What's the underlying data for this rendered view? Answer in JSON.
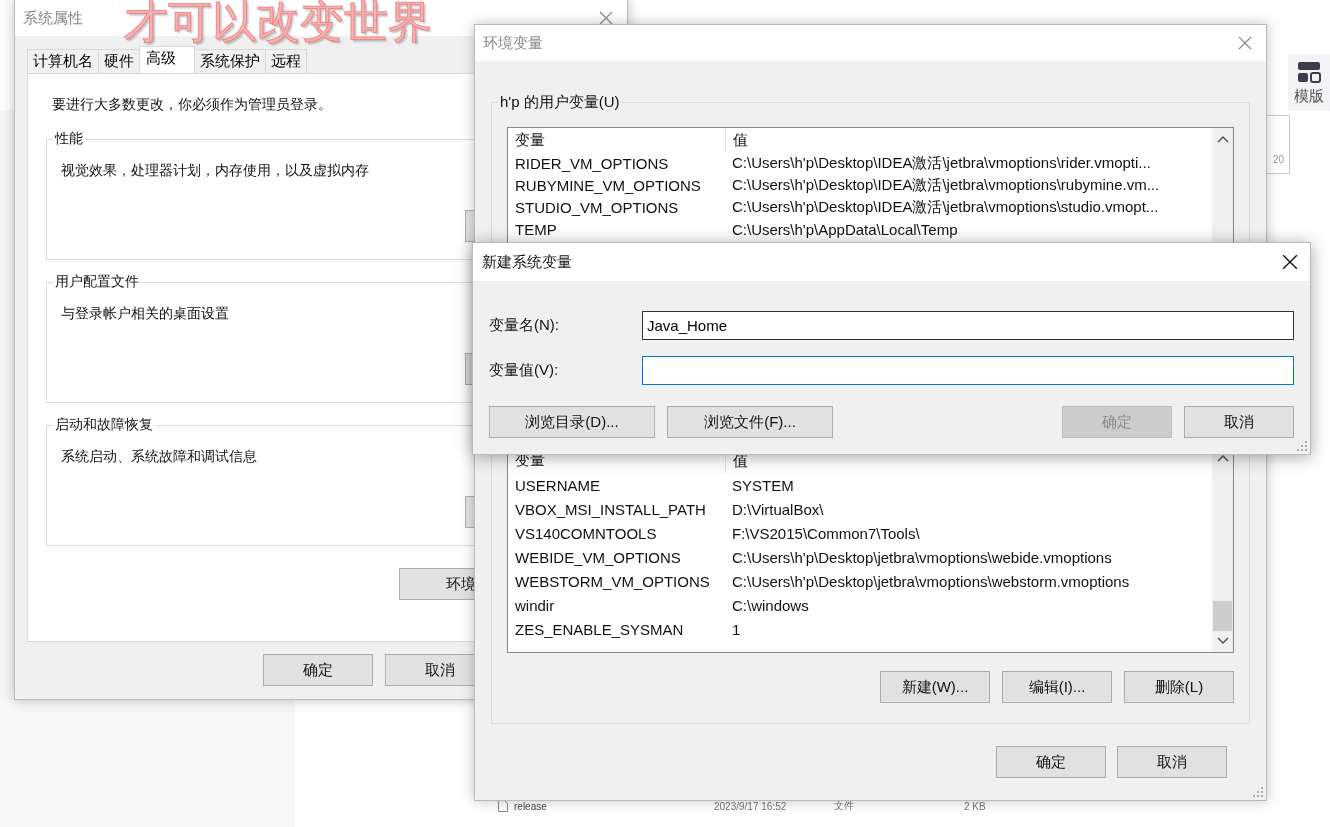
{
  "overlay_caption": "才可以改变世界",
  "background_app": {
    "toolbar_button": "模版",
    "thumbnail_label": "20",
    "file_row": {
      "name": "release",
      "modified": "2023/9/17 16:52",
      "type": "文件",
      "size": "2 KB"
    }
  },
  "system_properties": {
    "title": "系统属性",
    "tabs": [
      {
        "label": "计算机名",
        "selected": false
      },
      {
        "label": "硬件",
        "selected": false
      },
      {
        "label": "高级",
        "selected": true
      },
      {
        "label": "系统保护",
        "selected": false
      },
      {
        "label": "远程",
        "selected": false
      }
    ],
    "admin_note": "要进行大多数更改，你必须作为管理员登录。",
    "groups": [
      {
        "title": "性能",
        "description": "视觉效果，处理器计划，内存使用，以及虚拟内存"
      },
      {
        "title": "用户配置文件",
        "description": "与登录帐户相关的桌面设置"
      },
      {
        "title": "启动和故障恢复",
        "description": "系统启动、系统故障和调试信息"
      }
    ],
    "env_button": "环境",
    "buttons": [
      "确定",
      "取消"
    ]
  },
  "environment_variables": {
    "title": "环境变量",
    "user_group_title": "h'p 的用户变量(U)",
    "user_columns": [
      "变量",
      "值"
    ],
    "user_rows": [
      {
        "name": "RIDER_VM_OPTIONS",
        "value": "C:\\Users\\h'p\\Desktop\\IDEA激活\\jetbra\\vmoptions\\rider.vmopti..."
      },
      {
        "name": "RUBYMINE_VM_OPTIONS",
        "value": "C:\\Users\\h'p\\Desktop\\IDEA激活\\jetbra\\vmoptions\\rubymine.vm..."
      },
      {
        "name": "STUDIO_VM_OPTIONS",
        "value": "C:\\Users\\h'p\\Desktop\\IDEA激活\\jetbra\\vmoptions\\studio.vmopt..."
      },
      {
        "name": "TEMP",
        "value": "C:\\Users\\h'p\\AppData\\Local\\Temp"
      }
    ],
    "system_columns": [
      "变量",
      "值"
    ],
    "system_rows": [
      {
        "name": "USERNAME",
        "value": "SYSTEM"
      },
      {
        "name": "VBOX_MSI_INSTALL_PATH",
        "value": "D:\\VirtualBox\\"
      },
      {
        "name": "VS140COMNTOOLS",
        "value": "F:\\VS2015\\Common7\\Tools\\"
      },
      {
        "name": "WEBIDE_VM_OPTIONS",
        "value": "C:\\Users\\h'p\\Desktop\\jetbra\\vmoptions\\webide.vmoptions"
      },
      {
        "name": "WEBSTORM_VM_OPTIONS",
        "value": "C:\\Users\\h'p\\Desktop\\jetbra\\vmoptions\\webstorm.vmoptions"
      },
      {
        "name": "windir",
        "value": "C:\\windows"
      },
      {
        "name": "ZES_ENABLE_SYSMAN",
        "value": "1"
      }
    ],
    "system_buttons": [
      "新建(W)...",
      "编辑(I)...",
      "删除(L)"
    ],
    "buttons": [
      "确定",
      "取消"
    ]
  },
  "new_variable_dialog": {
    "title": "新建系统变量",
    "fields": [
      {
        "label": "变量名(N):",
        "value": "Java_Home",
        "focused": false
      },
      {
        "label": "变量值(V):",
        "focused": true
      }
    ],
    "buttons": [
      {
        "label": "浏览目录(D)...",
        "disabled": false,
        "kind": "left"
      },
      {
        "label": "浏览文件(F)...",
        "disabled": false,
        "kind": "left"
      },
      {
        "label": "确定",
        "disabled": true,
        "kind": "right"
      },
      {
        "label": "取消",
        "disabled": false,
        "kind": "right"
      }
    ]
  }
}
